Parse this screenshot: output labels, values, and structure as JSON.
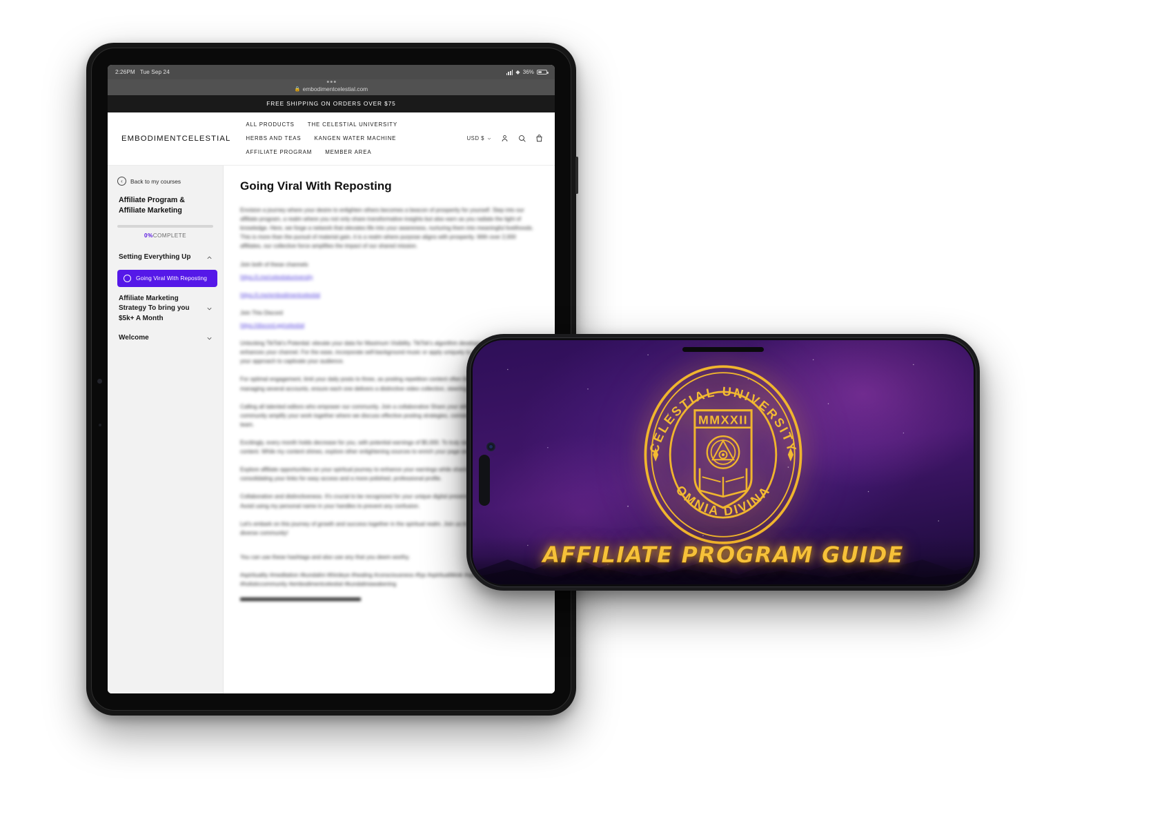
{
  "tablet": {
    "status_bar": {
      "time": "2:26PM",
      "date": "Tue Sep 24",
      "battery_percent": "36%",
      "signal_icon": "cellular-signal-icon",
      "wifi_icon": "wifi-icon",
      "battery_icon": "battery-icon"
    },
    "browser": {
      "url": "embodimentcelestial.com",
      "lock_icon": "lock-icon",
      "tabs_icon": "tab-dots-icon"
    },
    "promo_bar": "FREE SHIPPING ON ORDERS OVER $75",
    "site_header": {
      "brand": "EMBODIMENTCELESTIAL",
      "nav": [
        "ALL PRODUCTS",
        "THE CELESTIAL UNIVERSITY",
        "HERBS AND TEAS",
        "KANGEN WATER MACHINE",
        "AFFILIATE PROGRAM",
        "MEMBER AREA"
      ],
      "currency": "USD $",
      "currency_caret_icon": "chevron-down-icon",
      "account_icon": "user-icon",
      "search_icon": "search-icon",
      "cart_icon": "shopping-bag-icon"
    },
    "sidebar": {
      "back_label": "Back to my courses",
      "back_icon": "arrow-left-circle-icon",
      "course_title": "Affiliate Program & Affiliate Marketing",
      "progress_percent": "0%",
      "progress_word": "COMPLETE",
      "progress_value": 0,
      "modules": [
        {
          "label": "Setting Everything Up",
          "expanded": true,
          "icon": "chevron-up-icon"
        },
        {
          "label": "Affiliate Marketing Strategy To bring you $5k+ A Month",
          "expanded": false,
          "icon": "chevron-down-icon"
        },
        {
          "label": "Welcome",
          "expanded": false,
          "icon": "chevron-down-icon"
        }
      ],
      "active_lesson": {
        "label": "Going Viral With Reposting",
        "status_icon": "circle-outline-icon"
      }
    },
    "content": {
      "page_title": "Going Viral With Reposting",
      "paragraphs": [
        "Envision a journey where your desire to enlighten others becomes a beacon of prosperity for yourself. Step into our affiliate program, a realm where you not only share transformative insights but also earn as you radiate the light of knowledge. Here, we forge a network that elevates life into your awareness, nurturing them into meaningful livelihoods. This is more than the pursuit of material gain, it is a realm where purpose aligns with prosperity. With over 2,000 affiliates, our collective force amplifies the impact of our shared mission.",
        "Join both of these channels",
        "Join This Discord"
      ],
      "links": [
        "https://t.me/celestialuniversity",
        "https://t.me/embodimentcelestial",
        "https://discord.gg/celestial"
      ],
      "body_blocks": [
        "Unlocking TikTok's Potential: elevate your data for Maximum Visibility. TikTok's algorithm develops repeat videos and enhances your channel. For the ease, incorporate self-background music or apply uniquely to your content. Diversify your approach to captivate your audience.",
        "For optimal engagement, limit your daily posts to three, as posting repetition content often the same IP address. If you're managing several accounts, ensure each one delivers a distinctive video collection, steering clear of duplication.",
        "Calling all talented editors who empower our community. Join a collaborative Share your skills, and let our vibrant community amplify your work together where we discuss effective posting strategies, connect, and collaborate as a team.",
        "Excitingly, every month holds decrease for you, with potential earnings of $5,000. To truly stand out, diversify your content. While my content shines, explore other enlightening sources to enrich your page and boost its visibility.",
        "Explore affiliate opportunities on your spiritual journey to enhance your earnings while sharing with Linktree, consolidating your links for easy access and a more polished, professional profile.",
        "Collaboration and distinctiveness. It's crucial to be recognized for your unique digital presence, not a duplicate of mine. Avoid using my personal name in your handles to prevent any confusion.",
        "Let's embark on this journey of growth and success together in the spiritual realm. Join us in creating a vibrant and diverse community!",
        "You can use these hashtags and also use any that you deem worthy.",
        "#spirituality #meditation #kundalini #thirdeye #healing #consciousness #fyp #spiritualtiktok #spiritualawakening #vegan #holisticcommunity #embodimentcelestial #kundaliniawakening"
      ]
    }
  },
  "phone": {
    "seal": {
      "top_arc_text": "CELESTIAL UNIVERSITY",
      "bottom_arc_text": "OMNIA DIVINA",
      "year": "MMXXII",
      "emblem_icons": [
        "eye-in-triangle-icon",
        "open-book-icon",
        "star-icon"
      ]
    },
    "guide_title": "AFFILIATE PROGRAM GUIDE",
    "colors": {
      "gold": "#f6c13a",
      "purple_bg": "#43176d"
    }
  },
  "colors": {
    "accent_purple": "#5518e8",
    "progress_purple": "#5a18e0",
    "page_bg": "#ffffff",
    "sidebar_bg": "#f2f2f2"
  }
}
